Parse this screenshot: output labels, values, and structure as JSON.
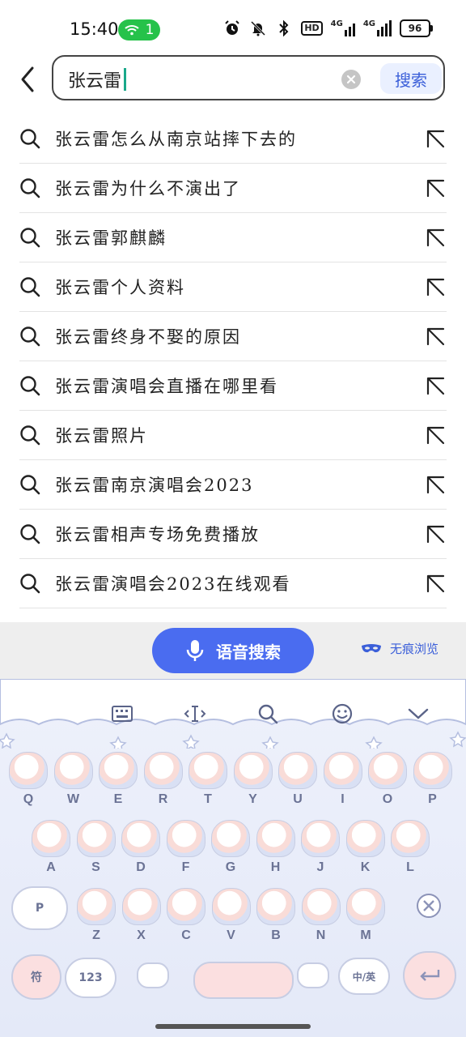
{
  "status": {
    "time": "15:40",
    "hotspot_count": "1",
    "hd": "HD",
    "net1": "4G",
    "net2": "4G",
    "battery": "96"
  },
  "search": {
    "value": "张云雷",
    "button_label": "搜索"
  },
  "suggestions": [
    "张云雷怎么从南京站摔下去的",
    "张云雷为什么不演出了",
    "张云雷郭麒麟",
    "张云雷个人资料",
    "张云雷终身不娶的原因",
    "张云雷演唱会直播在哪里看",
    "张云雷照片",
    "张云雷南京演唱会2023",
    "张云雷相声专场免费播放",
    "张云雷演唱会2023在线观看"
  ],
  "voice": {
    "voice_search_label": "语音搜索",
    "incognito_label": "无痕浏览"
  },
  "keyboard": {
    "row1": [
      "Q",
      "W",
      "E",
      "R",
      "T",
      "Y",
      "U",
      "I",
      "O",
      "P"
    ],
    "row2": [
      "A",
      "S",
      "D",
      "F",
      "G",
      "H",
      "J",
      "K",
      "L"
    ],
    "row3": [
      "Z",
      "X",
      "C",
      "V",
      "B",
      "N",
      "M"
    ],
    "shift_label": "P",
    "symbols_label": "符",
    "numbers_label": "123",
    "lang_label": "中/英"
  },
  "colors": {
    "accent": "#4a6cf0",
    "hotspot": "#26c24a",
    "caret": "#1aa88a"
  }
}
